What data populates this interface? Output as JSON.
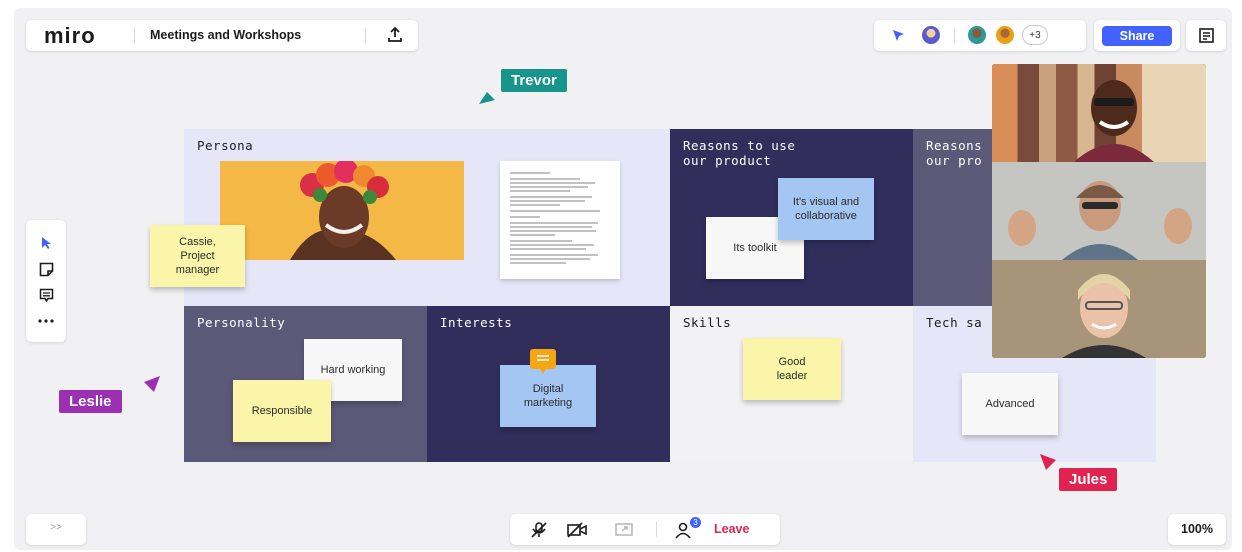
{
  "header": {
    "logo": "miro",
    "board_title": "Meetings and Workshops",
    "overflow_count": "+3",
    "share_label": "Share"
  },
  "board": {
    "cells": {
      "persona": "Persona",
      "reasons1": "Reasons to use\nour product",
      "reasons2": "Reasons\nour pro",
      "personality": "Personality",
      "interests": "Interests",
      "skills": "Skills",
      "tech": "Tech sa"
    },
    "stickies": {
      "cassie": "Cassie,\nProject\nmanager",
      "visual": "It's visual and\ncollaborative",
      "toolkit": "Its toolkit",
      "hard_working": "Hard working",
      "responsible": "Responsible",
      "digital": "Digital\nmarketing",
      "good_leader": "Good\nleader",
      "advanced": "Advanced"
    }
  },
  "cursors": {
    "trevor": "Trevor",
    "leslie": "Leslie",
    "jules": "Jules"
  },
  "bottom": {
    "expand_label": ">>",
    "participants_count": "3",
    "leave_label": "Leave",
    "zoom": "100%"
  },
  "colors": {
    "accent_blue": "#4262ff",
    "trevor": "#17948b",
    "leslie": "#9d2fb3",
    "jules": "#e0234f",
    "navy": "#312e5c",
    "slate": "#5c5878",
    "lavender": "#e5e6f7",
    "sticky_yellow": "#fbf5a9",
    "sticky_blue": "#a4c6f2"
  }
}
